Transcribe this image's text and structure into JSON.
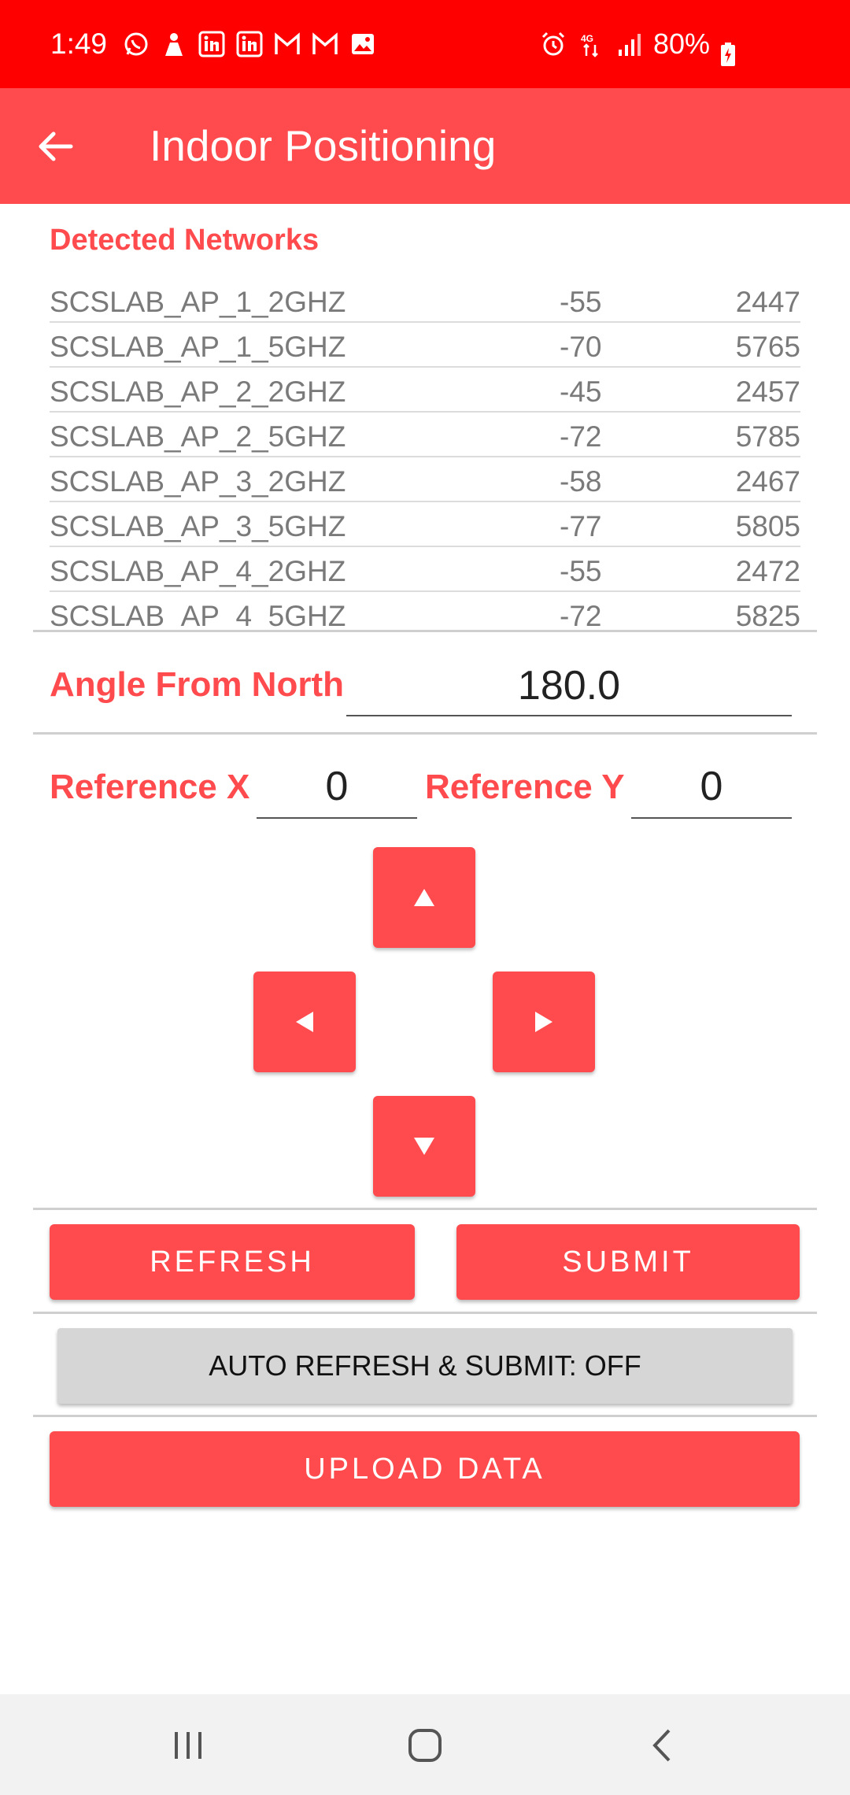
{
  "status_bar": {
    "time": "1:49",
    "notification_icons": [
      "whatsapp-icon",
      "teams-icon",
      "linkedin-icon",
      "linkedin-icon",
      "gmail-icon",
      "gmail-icon",
      "gallery-icon"
    ],
    "right_icons": [
      "alarm-icon",
      "4g-icon",
      "signal-icon"
    ],
    "battery": "80%",
    "background_color": "#ff0000"
  },
  "app_bar": {
    "title": "Indoor Positioning",
    "color": "#ff4b4e"
  },
  "networks": {
    "heading": "Detected Networks",
    "rows": [
      {
        "ssid": "SCSLAB_AP_1_2GHZ",
        "rssi": "-55",
        "freq": "2447"
      },
      {
        "ssid": "SCSLAB_AP_1_5GHZ",
        "rssi": "-70",
        "freq": "5765"
      },
      {
        "ssid": "SCSLAB_AP_2_2GHZ",
        "rssi": "-45",
        "freq": "2457"
      },
      {
        "ssid": "SCSLAB_AP_2_5GHZ",
        "rssi": "-72",
        "freq": "5785"
      },
      {
        "ssid": "SCSLAB_AP_3_2GHZ",
        "rssi": "-58",
        "freq": "2467"
      },
      {
        "ssid": "SCSLAB_AP_3_5GHZ",
        "rssi": "-77",
        "freq": "5805"
      },
      {
        "ssid": "SCSLAB_AP_4_2GHZ",
        "rssi": "-55",
        "freq": "2472"
      },
      {
        "ssid": "SCSLAB_AP_4_5GHZ",
        "rssi": "-72",
        "freq": "5825"
      }
    ]
  },
  "angle": {
    "label": "Angle From North",
    "value": "180.0"
  },
  "reference": {
    "x_label": "Reference X",
    "x_value": "0",
    "y_label": "Reference Y",
    "y_value": "0"
  },
  "dpad": {
    "up": "▲",
    "left": "◀",
    "right": "▶",
    "down": "▼"
  },
  "actions": {
    "refresh": "REFRESH",
    "submit": "SUBMIT",
    "auto": "AUTO REFRESH & SUBMIT: OFF",
    "upload": "UPLOAD DATA"
  }
}
